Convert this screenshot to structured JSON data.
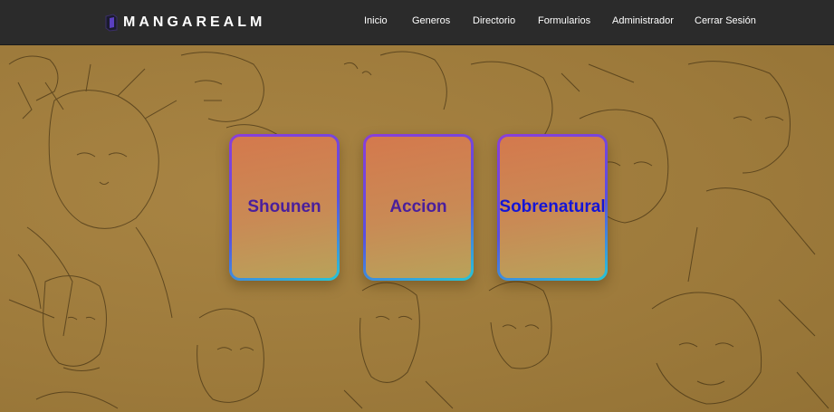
{
  "brand": {
    "name": "MANGAREALM",
    "icon": "cube-logo-icon"
  },
  "nav": {
    "items": [
      {
        "label": "Inicio"
      },
      {
        "label": "Generos"
      },
      {
        "label": "Directorio"
      },
      {
        "label": "Formularios"
      },
      {
        "label": "Administrador"
      },
      {
        "label": "Cerrar Sesión"
      }
    ]
  },
  "genres": {
    "cards": [
      {
        "label": "Shounen",
        "color": "#4a1f9c"
      },
      {
        "label": "Accion",
        "color": "#4a1f9c"
      },
      {
        "label": "Sobrenatural",
        "color": "#1515d6"
      }
    ]
  },
  "colors": {
    "navbar": "#2b2b2b",
    "background": "#9c7a3c",
    "card_border_start": "#8b3fd8",
    "card_border_end": "#25c7d8"
  }
}
